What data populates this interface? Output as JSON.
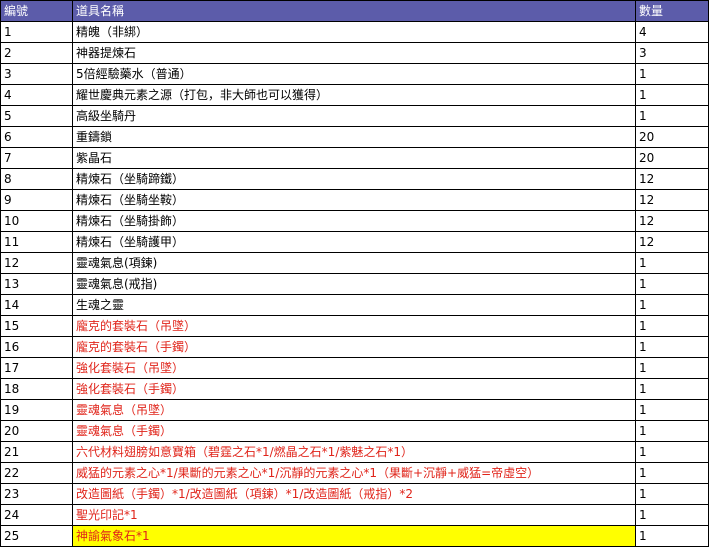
{
  "table": {
    "headers": [
      "編號",
      "道具名稱",
      "數量"
    ],
    "rows": [
      {
        "no": "1",
        "name": "精魄（非綁）",
        "qty": "4"
      },
      {
        "no": "2",
        "name": "神器提煉石",
        "qty": "3"
      },
      {
        "no": "3",
        "name": "5倍經驗藥水（普通）",
        "qty": "1"
      },
      {
        "no": "4",
        "name": "耀世慶典元素之源（打包，非大師也可以獲得）",
        "qty": "1"
      },
      {
        "no": "5",
        "name": "高級坐騎丹",
        "qty": "1"
      },
      {
        "no": "6",
        "name": "重鑄鎖",
        "qty": "20"
      },
      {
        "no": "7",
        "name": "紫晶石",
        "qty": "20"
      },
      {
        "no": "8",
        "name": "精煉石（坐騎蹄鐵）",
        "qty": "12"
      },
      {
        "no": "9",
        "name": "精煉石（坐騎坐鞍）",
        "qty": "12"
      },
      {
        "no": "10",
        "name": "精煉石（坐騎掛飾）",
        "qty": "12"
      },
      {
        "no": "11",
        "name": "精煉石（坐騎護甲）",
        "qty": "12"
      },
      {
        "no": "12",
        "name": "靈魂氣息(項鍊)",
        "qty": "1"
      },
      {
        "no": "13",
        "name": "靈魂氣息(戒指)",
        "qty": "1"
      },
      {
        "no": "14",
        "name": "生魂之靈",
        "qty": "1"
      },
      {
        "no": "15",
        "name": "龐克的套裝石（吊墜）",
        "qty": "1"
      },
      {
        "no": "16",
        "name": "龐克的套裝石（手鐲）",
        "qty": "1"
      },
      {
        "no": "17",
        "name": "強化套裝石（吊墜）",
        "qty": "1"
      },
      {
        "no": "18",
        "name": "強化套裝石（手鐲）",
        "qty": "1"
      },
      {
        "no": "19",
        "name": "靈魂氣息（吊墜）",
        "qty": "1"
      },
      {
        "no": "20",
        "name": "靈魂氣息（手鐲）",
        "qty": "1"
      },
      {
        "no": "21",
        "name": "六代材料翅膀如意寶箱（碧霆之石*1/燃晶之石*1/紫魅之石*1）",
        "qty": "1"
      },
      {
        "no": "22",
        "name": "威猛的元素之心*1/果斷的元素之心*1/沉靜的元素之心*1（果斷+沉靜+威猛=帝虛空）",
        "qty": "1"
      },
      {
        "no": "23",
        "name": "改造圖紙（手鐲）*1/改造圖紙（項鍊）*1/改造圖紙（戒指）*2",
        "qty": "1"
      },
      {
        "no": "24",
        "name": "聖光印記*1",
        "qty": "1"
      },
      {
        "no": "25",
        "name": "神諭氣象石*1",
        "qty": "1"
      }
    ]
  },
  "colors": {
    "header_bg": "#5c5caa",
    "header_text": "#ffffff",
    "red_text": "#e0241a",
    "highlight": "#ffff00"
  }
}
